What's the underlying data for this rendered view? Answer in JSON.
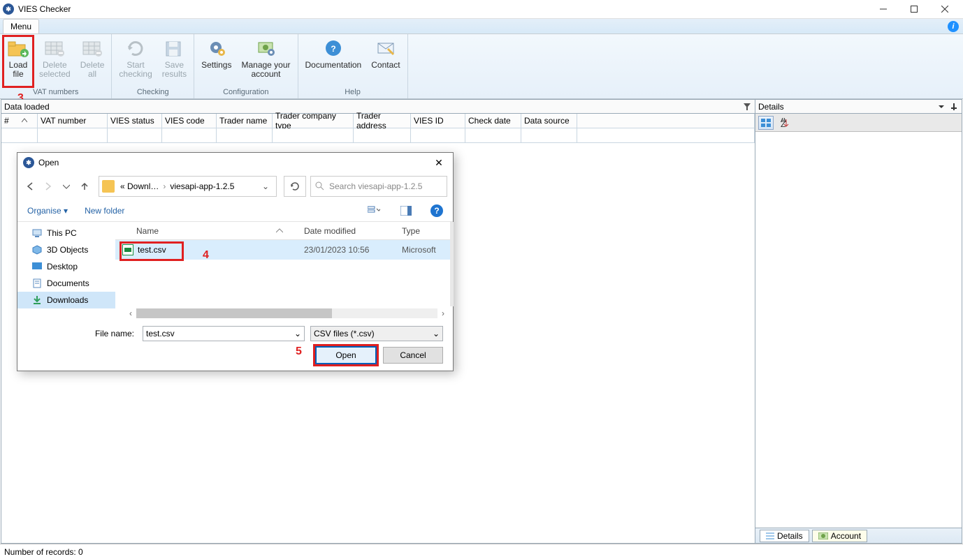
{
  "window": {
    "title": "VIES Checker"
  },
  "ribbon": {
    "menu_tab": "Menu",
    "groups": {
      "vat_numbers": {
        "label": "VAT numbers",
        "load_file": "Load\nfile",
        "delete_selected": "Delete\nselected",
        "delete_all": "Delete\nall"
      },
      "checking": {
        "label": "Checking",
        "start_checking": "Start\nchecking",
        "save_results": "Save\nresults"
      },
      "configuration": {
        "label": "Configuration",
        "settings": "Settings",
        "manage_account": "Manage your\naccount"
      },
      "help": {
        "label": "Help",
        "documentation": "Documentation",
        "contact": "Contact"
      }
    }
  },
  "data_pane": {
    "title": "Data loaded",
    "columns": [
      "#",
      "VAT number",
      "VIES status",
      "VIES code",
      "Trader name",
      "Trader company type",
      "Trader address",
      "VIES ID",
      "Check date",
      "Data source"
    ]
  },
  "details_pane": {
    "title": "Details"
  },
  "bottom_tabs": {
    "details": "Details",
    "account": "Account"
  },
  "statusbar": {
    "records": "Number of records: 0"
  },
  "annotations": {
    "load_file": "3",
    "file_row": "4",
    "open_btn": "5"
  },
  "dialog": {
    "title": "Open",
    "breadcrumb": {
      "left": "« Downl…",
      "right": "viesapi-app-1.2.5"
    },
    "search_placeholder": "Search viesapi-app-1.2.5",
    "toolbar": {
      "organise": "Organise ▾",
      "new_folder": "New folder"
    },
    "tree": [
      {
        "label": "This PC",
        "icon": "pc"
      },
      {
        "label": "3D Objects",
        "icon": "3d"
      },
      {
        "label": "Desktop",
        "icon": "desktop"
      },
      {
        "label": "Documents",
        "icon": "doc"
      },
      {
        "label": "Downloads",
        "icon": "down",
        "selected": true
      }
    ],
    "file_columns": {
      "name": "Name",
      "date": "Date modified",
      "type": "Type"
    },
    "file": {
      "name": "test.csv",
      "date": "23/01/2023 10:56",
      "type": "Microsoft"
    },
    "file_name_label": "File name:",
    "file_name_value": "test.csv",
    "filter": "CSV files (*.csv)",
    "open": "Open",
    "cancel": "Cancel"
  }
}
